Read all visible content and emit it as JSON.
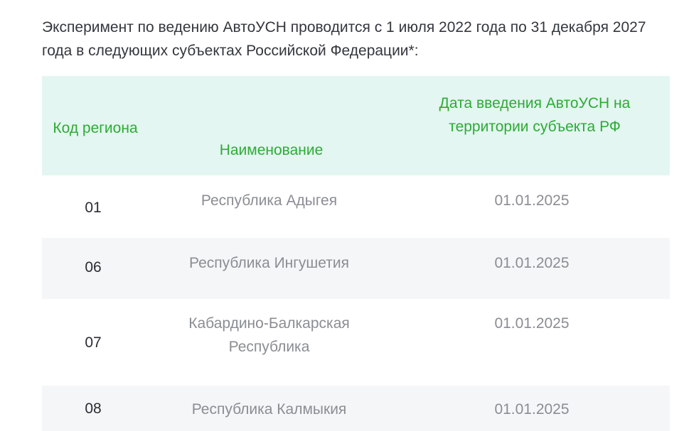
{
  "intro": {
    "text": "Эксперимент по ведению АвтоУСН проводится с 1 июля 2022 года по 31 декабря 2027 года в следующих субъектах Российской Федерации*:"
  },
  "table": {
    "headers": {
      "code": "Код региона",
      "name": "Наименование",
      "date": "Дата введения АвтоУСН на территории субъекта РФ"
    },
    "rows": [
      {
        "code": "01",
        "name": "Республика Адыгея",
        "date": "01.01.2025"
      },
      {
        "code": "06",
        "name": "Республика Ингушетия",
        "date": "01.01.2025"
      },
      {
        "code": "07",
        "name": "Кабардино-Балкарская Республика",
        "date": "01.01.2025"
      },
      {
        "code": "08",
        "name": "Республика Калмыкия",
        "date": "01.01.2025"
      }
    ]
  },
  "colors": {
    "header_bg": "#e3f6f1",
    "header_text": "#2dab35",
    "stripe_bg": "#f5f6f8",
    "body_text": "#8a8d92",
    "code_text": "#2a2d33"
  }
}
